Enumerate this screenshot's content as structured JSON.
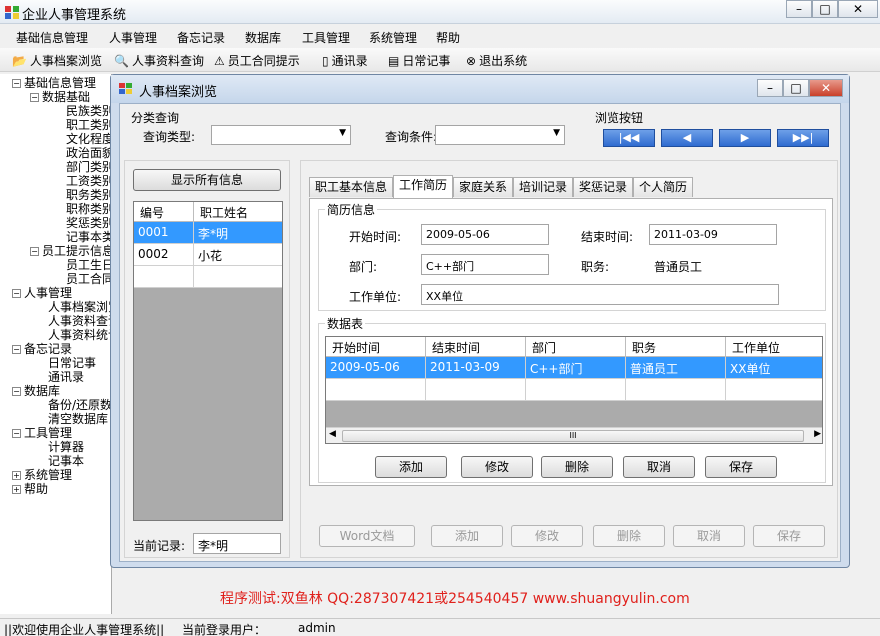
{
  "app": {
    "title": "企业人事管理系统",
    "win_min": "–",
    "win_max": "□",
    "win_close": "✕"
  },
  "menu": [
    "基础信息管理",
    "人事管理",
    "备忘记录",
    "数据库",
    "工具管理",
    "系统管理",
    "帮助"
  ],
  "toolbar": [
    {
      "icon": "folder-open-icon",
      "glyph": "📂",
      "label": "人事档案浏览"
    },
    {
      "icon": "search-icon",
      "glyph": "🔍",
      "label": "人事资料查询"
    },
    {
      "icon": "warning-icon",
      "glyph": "⚠",
      "label": "员工合同提示"
    },
    {
      "icon": "address-book-icon",
      "glyph": "▯",
      "label": "通讯录"
    },
    {
      "icon": "notebook-icon",
      "glyph": "▤",
      "label": "日常记事"
    },
    {
      "icon": "exit-icon",
      "glyph": "⊗",
      "label": "退出系统"
    }
  ],
  "tree": {
    "n0": "基础信息管理",
    "n1": "数据基础",
    "n2": "民族类别",
    "n3": "职工类别",
    "n4": "文化程度",
    "n5": "政治面貌",
    "n6": "部门类别",
    "n7": "工资类别",
    "n8": "职务类别",
    "n9": "职称类别",
    "n10": "奖惩类别",
    "n11": "记事本类",
    "n12": "员工提示信息",
    "n13": "员工生日",
    "n14": "员工合同",
    "n15": "人事管理",
    "n16": "人事档案浏览",
    "n17": "人事资料查询",
    "n18": "人事资料统计",
    "n19": "备忘记录",
    "n20": "日常记事",
    "n21": "通讯录",
    "n22": "数据库",
    "n23": "备份/还原数据库",
    "n24": "清空数据库",
    "n25": "工具管理",
    "n26": "计算器",
    "n27": "记事本",
    "n28": "系统管理",
    "n29": "帮助"
  },
  "child": {
    "title": "人事档案浏览",
    "btn_min": "–",
    "btn_max": "□",
    "btn_close": "✕",
    "classify": {
      "title": "分类查询",
      "type_label": "查询类型:",
      "cond_label": "查询条件:",
      "type_value": "",
      "cond_value": ""
    },
    "browse": {
      "title": "浏览按钮",
      "first": "|◀◀",
      "prev": "◀",
      "next": "▶",
      "last": "▶▶|"
    },
    "show_all": "显示所有信息",
    "emp_list": {
      "headers": [
        "编号",
        "职工姓名"
      ],
      "rows": [
        [
          "0001",
          "李*明"
        ],
        [
          "0002",
          "小花"
        ]
      ]
    },
    "current_label": "当前记录:",
    "current_value": "李*明",
    "tabs": [
      "职工基本信息",
      "工作简历",
      "家庭关系",
      "培训记录",
      "奖惩记录",
      "个人简历"
    ],
    "resume": {
      "title": "简历信息",
      "start_label": "开始时间:",
      "start_value": "2009-05-06",
      "end_label": "结束时间:",
      "end_value": "2011-03-09",
      "dept_label": "部门:",
      "dept_value": "C++部门",
      "post_label": "职务:",
      "post_value": "普通员工",
      "unit_label": "工作单位:",
      "unit_value": "XX单位"
    },
    "table": {
      "title": "数据表",
      "headers": [
        "开始时间",
        "结束时间",
        "部门",
        "职务",
        "工作单位"
      ],
      "rows": [
        [
          "2009-05-06",
          "2011-03-09",
          "C++部门",
          "普通员工",
          "XX单位"
        ]
      ],
      "scroll_mid": "III"
    },
    "tab_buttons": {
      "add": "添加",
      "modify": "修改",
      "delete": "删除",
      "cancel": "取消",
      "save": "保存"
    },
    "bottom_buttons": {
      "word": "Word文档",
      "add": "添加",
      "modify": "修改",
      "delete": "删除",
      "cancel": "取消",
      "save": "保存"
    }
  },
  "banner": "程序测试:双鱼林 QQ:287307421或254540457 www.shuangyulin.com",
  "status": {
    "welcome": "||欢迎使用企业人事管理系统||",
    "user_label": "当前登录用户：",
    "user_value": "admin"
  },
  "colors": {
    "selection": "#3399ff",
    "banner": "#e0211c",
    "nav_button": "#2f6bd0"
  }
}
